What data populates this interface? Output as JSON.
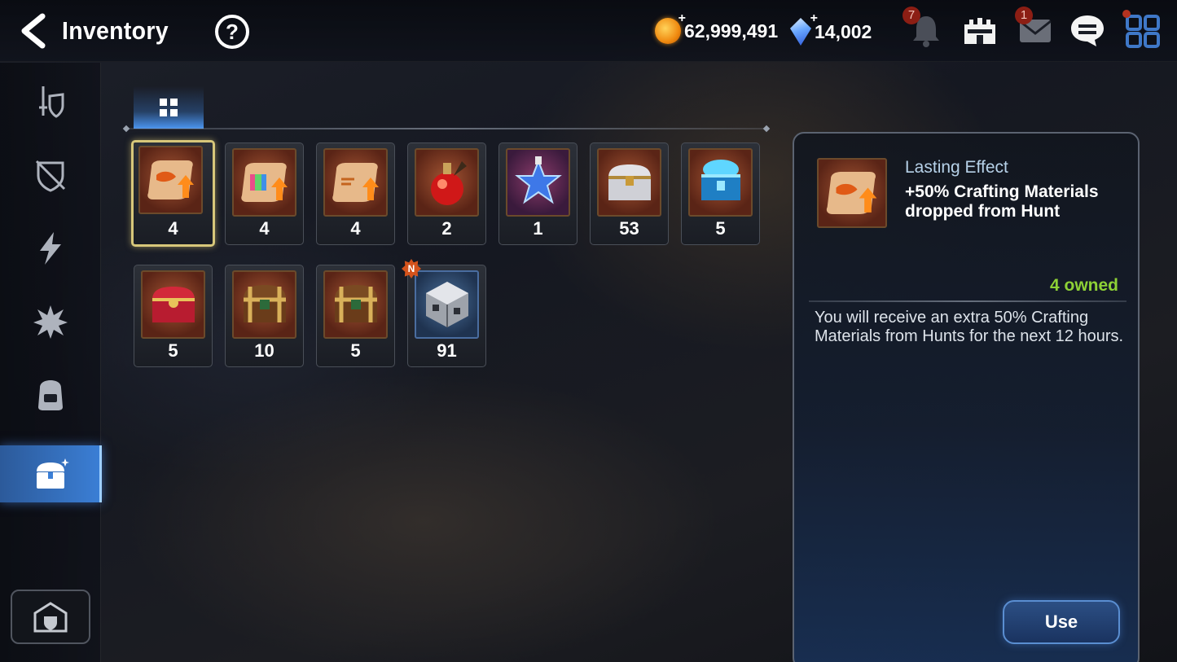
{
  "header": {
    "title": "Inventory",
    "help_label": "?",
    "gold_amount": "62,999,491",
    "gem_amount": "14,002",
    "plus_label": "+",
    "notification_badge": "7",
    "mail_badge": "1"
  },
  "tab": {
    "icon": "grid-icon"
  },
  "items": [
    {
      "icon": "scroll-upgrade-icon",
      "qty": "4",
      "selected": true
    },
    {
      "icon": "scroll-rainbow-cube-icon",
      "qty": "4"
    },
    {
      "icon": "scroll-gold-icon",
      "qty": "4"
    },
    {
      "icon": "red-potion-icon",
      "qty": "2"
    },
    {
      "icon": "star-potion-icon",
      "qty": "1"
    },
    {
      "icon": "silver-chest-icon",
      "qty": "53"
    },
    {
      "icon": "blue-chest-icon",
      "qty": "5"
    },
    {
      "icon": "red-chest-icon",
      "qty": "5"
    },
    {
      "icon": "golden-chest-icon",
      "qty": "10"
    },
    {
      "icon": "golden-chest-icon",
      "qty": "5"
    },
    {
      "icon": "silver-cube-icon",
      "qty": "91",
      "badge": "N"
    }
  ],
  "detail": {
    "type": "Lasting Effect",
    "name": "+50% Crafting Materials dropped from Hunt",
    "owned": "4 owned",
    "description": "You will receive an extra 50% Crafting Materials from Hunts for the next 12 hours.",
    "use_label": "Use"
  },
  "sidebar": {
    "items": [
      {
        "icon": "sword-shield-icon"
      },
      {
        "icon": "broken-shield-icon"
      },
      {
        "icon": "lightning-icon"
      },
      {
        "icon": "spiky-star-icon"
      },
      {
        "icon": "backpack-icon"
      },
      {
        "icon": "treasure-chest-icon",
        "active": true
      }
    ],
    "bottom_icon": "guild-hall-icon"
  },
  "colors": {
    "accent_blue": "#3b7fd6",
    "selected_gold": "#d7c77a",
    "owned_green": "#8ed136"
  }
}
